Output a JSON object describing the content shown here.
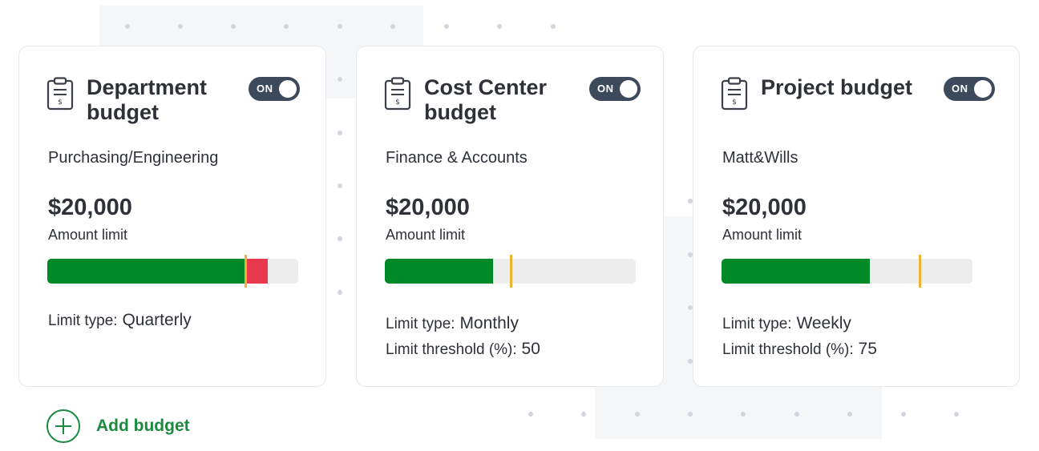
{
  "cards": [
    {
      "title": "Department budget",
      "toggle": "ON",
      "subtitle": "Purchasing/Engineering",
      "amount": "$20,000",
      "amount_label": "Amount limit",
      "limit_type_label": "Limit type:",
      "limit_type_value": "Quarterly",
      "usage_fraction": 0.88,
      "threshold_fraction": 0.79
    },
    {
      "title": "Cost Center budget",
      "toggle": "ON",
      "subtitle": "Finance & Accounts",
      "amount": "$20,000",
      "amount_label": "Amount limit",
      "limit_type_label": "Limit type:",
      "limit_type_value": "Monthly",
      "threshold_label": "Limit threshold (%):",
      "threshold_value": "50",
      "usage_fraction": 0.43,
      "threshold_fraction": 0.5
    },
    {
      "title": "Project budget",
      "toggle": "ON",
      "subtitle": "Matt&Wills",
      "amount": "$20,000",
      "amount_label": "Amount limit",
      "limit_type_label": "Limit type:",
      "limit_type_value": "Weekly",
      "threshold_label": "Limit threshold (%):",
      "threshold_value": "75",
      "usage_fraction": 0.59,
      "threshold_fraction": 0.79
    }
  ],
  "add_budget_label": "Add budget",
  "colors": {
    "usage": "#008a27",
    "overage": "#e8394f",
    "threshold_marker": "#f2b230",
    "toggle_on": "#3d4a5c",
    "accent": "#1b8a3f"
  },
  "icons": {
    "card": "clipboard-dollar-icon",
    "add": "plus-circle-icon"
  }
}
